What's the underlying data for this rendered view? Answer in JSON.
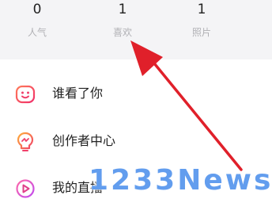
{
  "stats": [
    {
      "value": "0",
      "label": "人气"
    },
    {
      "value": "1",
      "label": "喜欢"
    },
    {
      "value": "1",
      "label": "照片"
    }
  ],
  "menu": [
    {
      "label": "谁看了你",
      "icon": "smiley-face-icon"
    },
    {
      "label": "创作者中心",
      "icon": "creator-lightbulb-icon"
    },
    {
      "label": "我的直播",
      "icon": "play-circle-icon"
    }
  ],
  "watermark": "1233News",
  "colors": {
    "accent": "#f0406a",
    "arrow": "#e0202a",
    "panel_bg": "#f4f4f6",
    "watermark": "#468ceb"
  }
}
